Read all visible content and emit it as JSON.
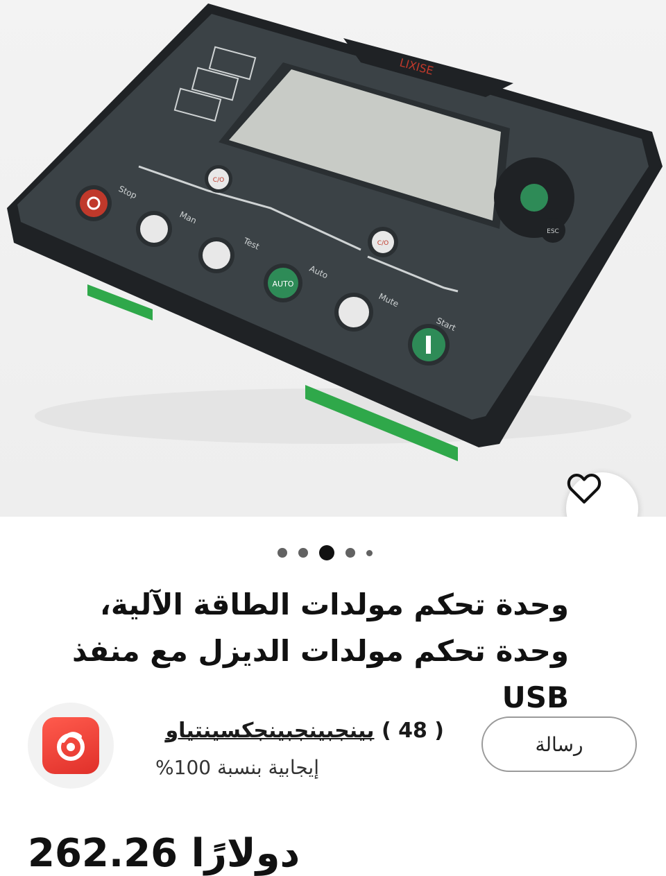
{
  "product": {
    "brand_mark": "LIXISE",
    "panel_labels": {
      "stop": "Stop",
      "man": "Man",
      "test": "Test",
      "auto": "Auto",
      "mute": "Mute",
      "start": "Start",
      "esc": "ESC",
      "co": "C/O",
      "auto_key": "AUTO"
    },
    "title": "وحدة تحكم مولدات الطاقة الآلية، وحدة تحكم مولدات الديزل مع منفذ USB",
    "gallery": {
      "dot_count": 5,
      "active_index": 2
    },
    "favorite_icon": "heart-icon"
  },
  "store": {
    "logo_icon": "store-logo-icon",
    "name": "بينجبينجبينجكسينتياو",
    "review_count": "( 48 )",
    "rating": "إيجابية بنسبة 100%"
  },
  "actions": {
    "message_label": "رسالة"
  },
  "price": {
    "amount": "262.26",
    "currency": "دولارًا"
  },
  "colors": {
    "accent_red": "#e0302a",
    "text": "#111111"
  }
}
